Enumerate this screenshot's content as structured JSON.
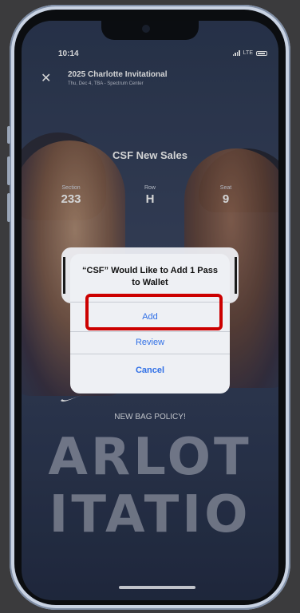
{
  "status_bar": {
    "time": "10:14",
    "carrier": "LTE"
  },
  "header": {
    "event_title": "2025 Charlotte Invitational",
    "event_subtitle": "Thu, Dec 4, TBA - Spectrum Center"
  },
  "ticket": {
    "type": "CSF New Sales",
    "section_label": "Section",
    "section_value": "233",
    "row_label": "Row",
    "row_value": "H",
    "seat_label": "Seat",
    "seat_value": "9"
  },
  "promo": {
    "bag_policy": "NEW BAG POLICY!",
    "big_line_1": "ARLOT",
    "big_line_2": "ITATIO"
  },
  "alert": {
    "title": "“CSF” Would Like to Add 1 Pass to Wallet",
    "add_label": "Add",
    "review_label": "Review",
    "cancel_label": "Cancel"
  },
  "colors": {
    "accent": "#2f6fe6",
    "highlight": "#cc0000"
  }
}
